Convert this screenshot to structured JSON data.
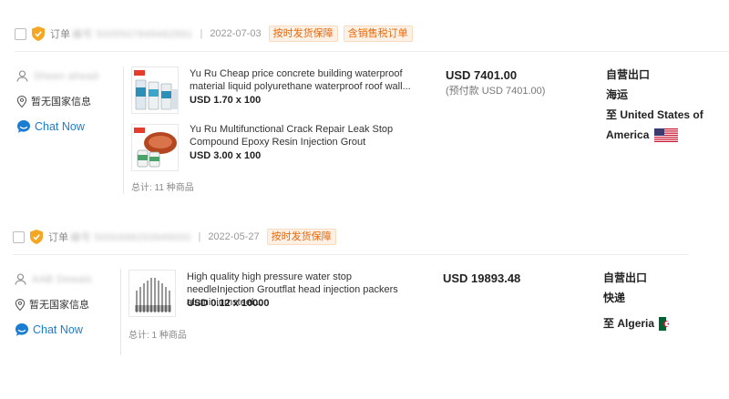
{
  "orders": [
    {
      "order_label": "订单",
      "order_number_masked": "编号 5005507849482891",
      "separator": "|",
      "date": "2022-07-03",
      "tags": [
        "按时发货保障",
        "含销售税订单"
      ],
      "seller": {
        "name_masked": "Sheen ahead",
        "country_info": "暂无国家信息",
        "chat_label": "Chat Now"
      },
      "products": [
        {
          "title": "Yu Ru Cheap price concrete building waterproof material liquid polyurethane waterproof roof wall...",
          "qty": "USD 1.70 x 100"
        },
        {
          "title": "Yu Ru Multifunctional Crack Repair Leak Stop Compound Epoxy Resin Injection Grout",
          "qty": "USD 3.00 x 100"
        }
      ],
      "total": "总计: 11 种商品",
      "price": "USD 7401.00",
      "prepaid": "(预付款 USD 7401.00)",
      "shipping": {
        "line1": "自营出口",
        "line2": "海运",
        "destination_prefix": "至",
        "destination_line1": "United States of",
        "destination_line2": "America",
        "flag": "us-flag"
      }
    },
    {
      "order_label": "订单",
      "order_number_masked": "编号 5000498293949000",
      "separator": "|",
      "date": "2022-05-27",
      "tags": [
        "按时发货保障"
      ],
      "seller": {
        "name_masked": "AAB Dewals",
        "country_info": "暂无国家信息",
        "chat_label": "Chat Now"
      },
      "products": [
        {
          "title": "High quality high pressure water stop needleInjection Groutflat head injection packers aluminiumsteel...",
          "qty": "USD 0.12 x 10000"
        }
      ],
      "total": "总计: 1 种商品",
      "price": "USD 19893.48",
      "prepaid": "",
      "shipping": {
        "line1": "自营出口",
        "line2": "快递",
        "destination_prefix": "至",
        "destination_line1": "Algeria",
        "destination_line2": "",
        "flag": "algeria-flag"
      }
    }
  ],
  "colors": {
    "accent_link": "#1a7dd1",
    "tag_text": "#e8690c",
    "tag_bg": "#fdf0e4",
    "shield": "#f5a623"
  }
}
